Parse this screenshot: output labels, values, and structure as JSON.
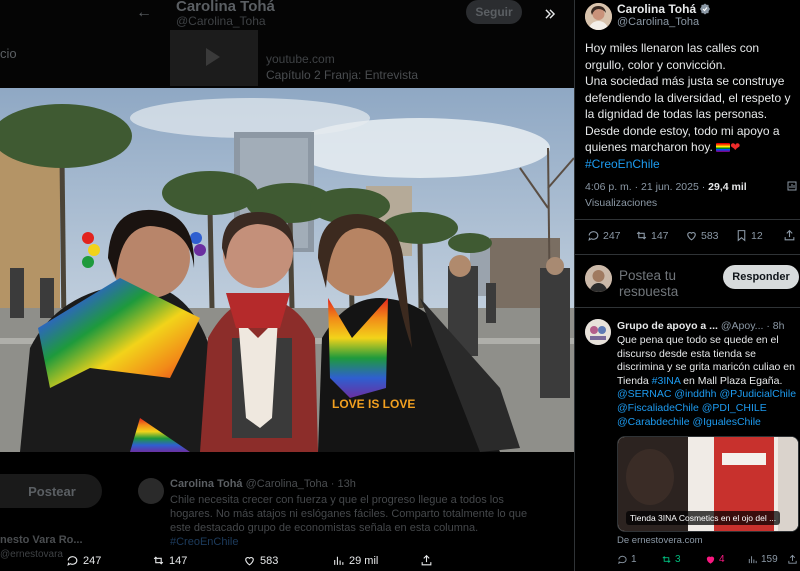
{
  "background": {
    "author_name": "Carolina Tohá",
    "author_handle": "@Carolina_Toha",
    "follow_label": "Seguir",
    "side_label": "cio",
    "link_domain": "youtube.com",
    "link_title": "Capítulo 2 Franja: Entrevista",
    "post_button": "Postear",
    "sidebar_user": "nesto Vara Ro...",
    "sidebar_handle": "@ernestovara",
    "tweet": {
      "author": "Carolina Tohá",
      "handle": "@Carolina_Toha · 13h",
      "text": "Chile necesita crecer con fuerza y que el progreso llegue a todos los hogares. No más atajos ni eslóganes fáciles. Comparto totalmente lo que este destacado grupo de economistas señala en esta columna.",
      "hashtag": "#CreoEnChile"
    }
  },
  "media_bar": {
    "replies": "247",
    "reposts": "147",
    "likes": "583",
    "views": "29 mil"
  },
  "post": {
    "author_name": "Carolina Tohá",
    "author_handle": "@Carolina_Toha",
    "text_line1": "Hoy miles llenaron las calles con orgullo, color y convicción.",
    "text_line2": "Una sociedad más justa se construye defendiendo la diversidad, el respeto y la dignidad de todas las personas.",
    "text_line3": "Desde donde estoy, todo mi apoyo a quienes marcharon hoy.",
    "hashtag": "#CreoEnChile",
    "time": "4:06 p. m. · 21 jun. 2025 · ",
    "views_count": "29,4 mil",
    "views_label": "Visualizaciones",
    "replies": "247",
    "reposts": "147",
    "likes": "583",
    "bookmarks": "12"
  },
  "composer": {
    "placeholder": "Postea tu respuesta",
    "button": "Responder"
  },
  "reply": {
    "author": "Grupo de apoyo a ...",
    "handle": "@Apoy...",
    "time": "· 8h",
    "text_start": "Que pena que todo se quede en el discurso desde esta tienda se discrimina y se grita maricón culiao en Tienda ",
    "hashtag": "#3INA",
    "text_mid": " en Mall Plaza Egaña.",
    "mentions": "@SERNAC @inddhh @PJudicialChile @FiscaliadeChile @PDI_CHILE @Carabdechile @IgualesChile",
    "card_caption": "Tienda 3INA Cosmetics en el ojo del ...",
    "card_source": "De ernestovera.com",
    "replies": "1",
    "reposts": "3",
    "likes": "4",
    "views": "159"
  }
}
